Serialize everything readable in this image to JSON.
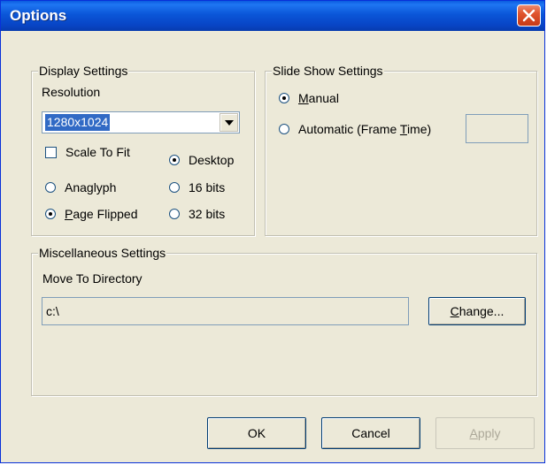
{
  "window": {
    "title": "Options",
    "close_icon": "close-icon"
  },
  "display_settings": {
    "legend": "Display Settings",
    "resolution_label": "Resolution",
    "resolution_value": "1280x1024",
    "scale_to_fit_label": "Scale To Fit",
    "scale_to_fit_checked": false,
    "mode_options": [
      {
        "label": "Anaglyph",
        "checked": false
      },
      {
        "label_underlined": "P",
        "label_rest": "age Flipped",
        "checked": true
      }
    ],
    "depth_options": [
      {
        "label": "Desktop",
        "checked": true
      },
      {
        "label": "16 bits",
        "checked": false
      },
      {
        "label": "32 bits",
        "checked": false
      }
    ]
  },
  "slide_show_settings": {
    "legend": "Slide Show Settings",
    "manual_label_underlined": "M",
    "manual_label_rest": "anual",
    "manual_checked": true,
    "automatic_label_before": "Automatic (Frame ",
    "automatic_label_underlined": "T",
    "automatic_label_after": "ime)",
    "automatic_checked": false,
    "frame_time_value": ""
  },
  "misc_settings": {
    "legend": "Miscellaneous Settings",
    "move_to_directory_label": "Move To Directory",
    "directory_value": "c:\\",
    "change_button_underlined": "C",
    "change_button_rest": "hange..."
  },
  "footer": {
    "ok_label": "OK",
    "cancel_label": "Cancel",
    "apply_label_underlined": "A",
    "apply_label_rest": "pply",
    "apply_disabled": true
  }
}
